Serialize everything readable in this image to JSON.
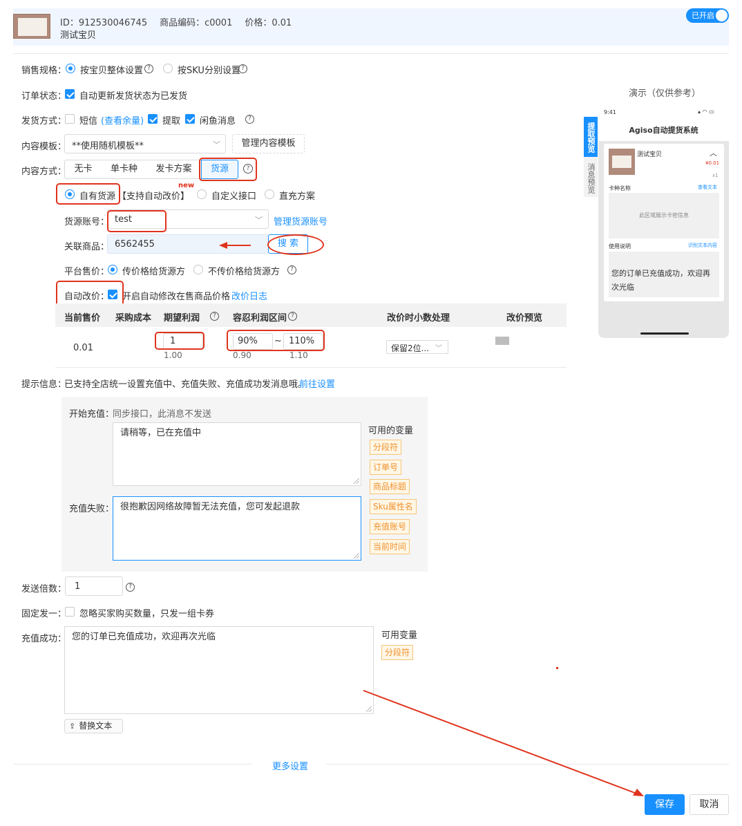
{
  "header": {
    "id_text": "ID：912530046745",
    "code_text": "商品编码：c0001",
    "price_text": "价格：0.01",
    "product_name": "测试宝贝",
    "toggle_label": "已开启"
  },
  "form": {
    "sale_spec": {
      "label": "销售规格：",
      "opt1": "按宝贝整体设置",
      "opt2": "按SKU分别设置"
    },
    "order_status": {
      "label": "订单状态：",
      "text": "自动更新发货状态为已发货"
    },
    "ship_method": {
      "label": "发货方式：",
      "sms": "短信",
      "sms_link": "(查看余量)",
      "pickup": "提取",
      "xianyu": "闲鱼消息"
    },
    "template": {
      "label": "内容模板：",
      "value": "**使用随机模板**",
      "manage": "管理内容模板"
    },
    "content_mode": {
      "label": "内容方式：",
      "tabs": [
        "无卡",
        "单卡种",
        "发卡方案",
        "货源"
      ]
    },
    "source_type": {
      "opt1": "自有货源",
      "opt1_note": "【支持自动改价】",
      "new_badge": "new",
      "opt2": "自定义接口",
      "opt3": "直充方案"
    },
    "source_account": {
      "label": "货源账号：",
      "value": "test",
      "manage": "管理货源账号"
    },
    "linked_product": {
      "label": "关联商品：",
      "value": "6562455",
      "search": "搜 索"
    },
    "platform_price": {
      "label": "平台售价：",
      "opt1": "传价格给货源方",
      "opt2": "不传价格给货源方"
    },
    "auto_price": {
      "label": "自动改价：",
      "text": "开启自动修改在售商品价格",
      "log_link": "改价日志"
    },
    "price_table": {
      "headers": [
        "当前售价",
        "采购成本",
        "期望利润",
        "容忍利润区间",
        "改价时小数处理",
        "改价预览"
      ],
      "current": "0.01",
      "profit": "1",
      "profit_sub": "1.00",
      "range_min": "90%",
      "range_sep": "~",
      "range_max": "110%",
      "range_min_sub": "0.90",
      "range_max_sub": "1.10",
      "decimal": "保留2位..."
    },
    "tip": {
      "label": "提示信息：",
      "text": "已支持全店统一设置充值中、充值失败、充值成功发消息哦。",
      "link": "前往设置"
    },
    "msg_panel": {
      "start_label": "开始充值：",
      "start_note": "同步接口，此消息不发送",
      "start_text": "请稍等，已在充值中",
      "fail_label": "充值失败：",
      "fail_text": "很抱歉因网络故障暂无法充值，您可发起退款",
      "vars_title": "可用的变量",
      "vars": [
        "分段符",
        "订单号",
        "商品标题",
        "Sku属性名",
        "充值账号",
        "当前时间"
      ]
    },
    "multiplier": {
      "label": "发送倍数：",
      "value": "1"
    },
    "fixed_one": {
      "label": "固定发一：",
      "text": "忽略买家购买数量，只发一组卡券"
    },
    "success": {
      "label": "充值成功：",
      "text": "您的订单已充值成功，欢迎再次光临",
      "vars_title": "可用变量",
      "var1": "分段符",
      "replace_btn": "替换文本"
    },
    "more": "更多设置"
  },
  "preview": {
    "title": "演示（仅供参考）",
    "side_tab1": "提取预览",
    "side_tab2": "消息预览",
    "time": "9:41",
    "app_title": "Agiso自动提货系统",
    "product": "测试宝贝",
    "price": "¥0.01",
    "qty": "x1",
    "card_label": "卡种名称",
    "view_text": "查看文本",
    "card_area": "此区域展示卡密信息",
    "usage_label": "使用说明",
    "copy_text": "识别文本内容",
    "usage_text": "您的订单已充值成功，欢迎再次光临"
  },
  "footer": {
    "save": "保存",
    "cancel": "取消"
  },
  "colors": {
    "primary": "#1890ff",
    "annotation_red": "#e0331c",
    "tag_orange": "#f0912d"
  }
}
